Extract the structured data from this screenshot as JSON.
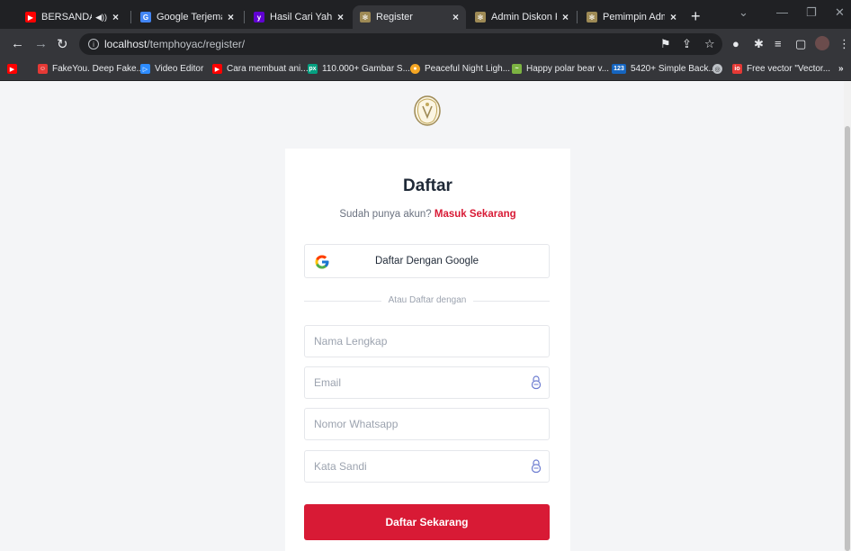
{
  "browser": {
    "tabs": [
      {
        "title": "BERSANDARLA",
        "favicon": "youtube-icon",
        "favicon_color": "#ff0000"
      },
      {
        "title": "Google Terjemahan",
        "favicon": "google-translate-icon",
        "favicon_color": "#4285f4"
      },
      {
        "title": "Hasil Cari Yahoo un",
        "favicon": "yahoo-icon",
        "favicon_color": "#6001d2"
      },
      {
        "title": "Register",
        "favicon": "site-logo-icon",
        "favicon_color": "#9e8a55"
      },
      {
        "title": "Admin Diskon Prod",
        "favicon": "site-logo-icon",
        "favicon_color": "#9e8a55"
      },
      {
        "title": "Pemimpin Admin A",
        "favicon": "site-logo-icon",
        "favicon_color": "#9e8a55"
      }
    ],
    "active_tab_index": 3,
    "address": {
      "host": "localhost",
      "path": "/temphoyac/register/"
    },
    "bookmarks": [
      {
        "label": "FakeYou. Deep Fake...",
        "favicon_color": "#e53935"
      },
      {
        "label": "Video Editor",
        "favicon_color": "#2d8cff"
      },
      {
        "label": "Cara membuat ani...",
        "favicon_color": "#ff0000"
      },
      {
        "label": "110.000+ Gambar S...",
        "favicon_color": "#05a081"
      },
      {
        "label": "Peaceful Night Ligh...",
        "favicon_color": "#f5a623"
      },
      {
        "label": "Happy polar bear v...",
        "favicon_color": "#7cb342"
      },
      {
        "label": "5420+ Simple Back...",
        "favicon_color": "#1565c0"
      },
      {
        "label": "",
        "favicon_color": "#bdc1c6"
      },
      {
        "label": "Free vector \"Vector...",
        "favicon_color": "#e53935"
      }
    ]
  },
  "register": {
    "title": "Daftar",
    "subtitle": "Sudah punya akun?",
    "login_link": "Masuk Sekarang",
    "google_button": "Daftar Dengan Google",
    "divider_text": "Atau Daftar dengan",
    "fields": {
      "name_placeholder": "Nama Lengkap",
      "email_placeholder": "Email",
      "whatsapp_placeholder": "Nomor Whatsapp",
      "password_placeholder": "Kata Sandi"
    },
    "submit_button": "Daftar Sekarang"
  },
  "colors": {
    "accent": "#d81a35",
    "page_bg": "#f4f5f7",
    "chrome_dark": "#202124",
    "chrome_mid": "#35363a"
  }
}
